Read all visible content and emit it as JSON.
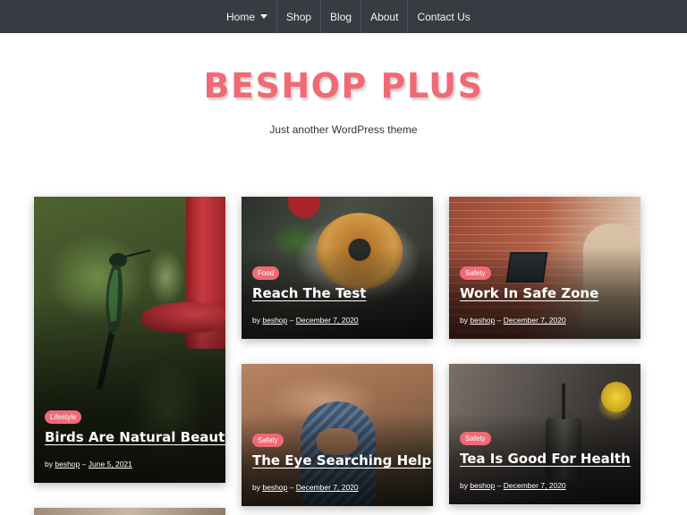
{
  "nav": {
    "items": [
      {
        "label": "Home",
        "has_dropdown": true
      },
      {
        "label": "Shop"
      },
      {
        "label": "Blog"
      },
      {
        "label": "About"
      },
      {
        "label": "Contact Us"
      }
    ]
  },
  "header": {
    "title": "BESHOP PLUS",
    "description": "Just another WordPress theme"
  },
  "colors": {
    "accent": "#f06a76",
    "nav_bg": "#373b42"
  },
  "posts": [
    {
      "category": "Lifestyle",
      "title": "Birds Are Natural Beauty",
      "by": "by",
      "author": "beshop",
      "sep": "–",
      "date": "June 5, 2021",
      "image": "hummingbird-feeder"
    },
    {
      "category": "Food",
      "title": "Reach The Test",
      "by": "by",
      "author": "beshop",
      "sep": "–",
      "date": "December 7, 2020",
      "image": "bagel-plate"
    },
    {
      "category": "Safety",
      "title": "Work In Safe Zone",
      "by": "by",
      "author": "beshop",
      "sep": "–",
      "date": "December 7, 2020",
      "image": "laptop-brick-wall"
    },
    {
      "category": "Safety",
      "title": "The Eye Searching Help",
      "by": "by",
      "author": "beshop",
      "sep": "–",
      "date": "December 7, 2020",
      "image": "person-headscarf-desert"
    },
    {
      "category": "Safety",
      "title": "Tea Is Good For Health",
      "by": "by",
      "author": "beshop",
      "sep": "–",
      "date": "December 7, 2020",
      "image": "tea-press-flowers"
    }
  ]
}
